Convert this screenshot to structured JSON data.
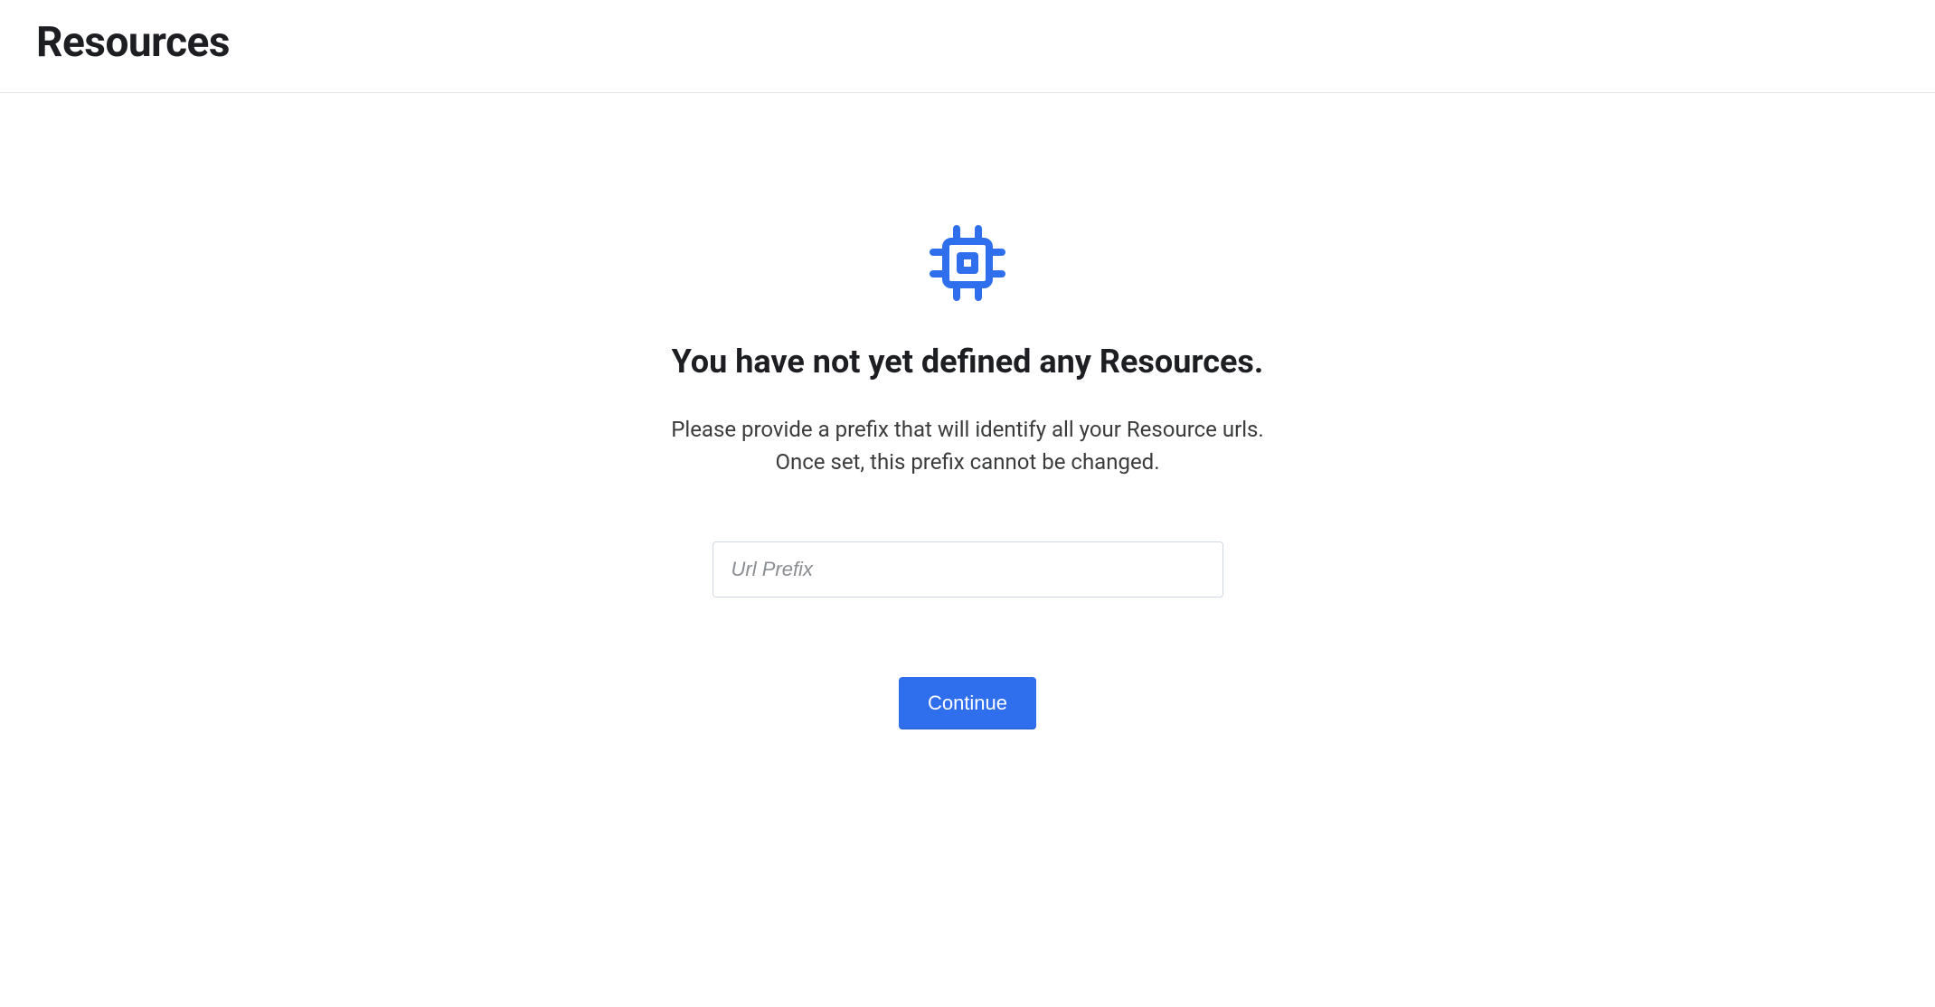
{
  "page": {
    "title": "Resources"
  },
  "empty_state": {
    "heading": "You have not yet defined any Resources.",
    "description_line1": "Please provide a prefix that will identify all your Resource urls.",
    "description_line2": "Once set, this prefix cannot be changed.",
    "input_placeholder": "Url Prefix",
    "continue_label": "Continue"
  },
  "colors": {
    "accent": "#2f6fed",
    "text_primary": "#1c1e21",
    "text_secondary": "#3a3b3c",
    "border": "#e4e6eb"
  }
}
